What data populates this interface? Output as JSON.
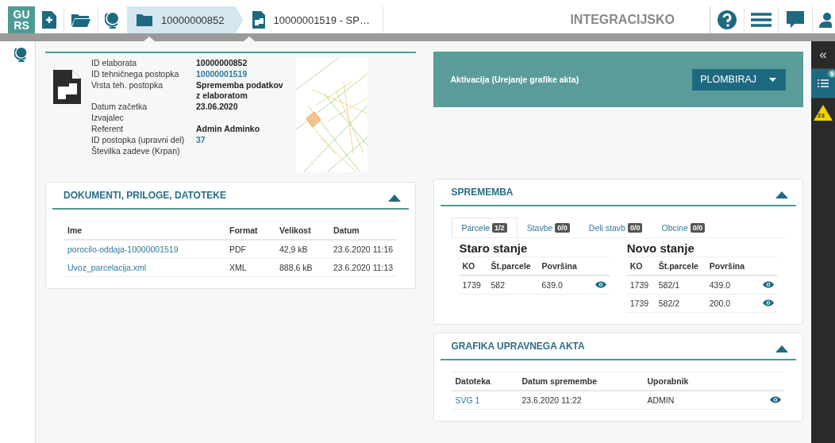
{
  "header": {
    "logo": [
      "GU",
      "RS"
    ],
    "breadcrumbs": [
      {
        "label": "10000000852",
        "selected": true
      },
      {
        "label": "10000001519 - SP…",
        "selected": false
      }
    ],
    "environment": "INTEGRACIJSKO"
  },
  "right_rail": {
    "collapse": "«",
    "badges": [
      {
        "count": "9",
        "kind": "list"
      },
      {
        "count": "23",
        "kind": "warning"
      }
    ]
  },
  "info": {
    "fields": [
      {
        "label": "ID elaborata",
        "value": "10000000852",
        "kind": "text"
      },
      {
        "label": "ID tehničnega postopka",
        "value": "10000001519",
        "kind": "link"
      },
      {
        "label": "Vrsta teh. postopka",
        "value": "Sprememba podatkov z elaboratom",
        "kind": "text"
      },
      {
        "label": "Datum začetka",
        "value": "23.06.2020",
        "kind": "text"
      },
      {
        "label": "Izvajalec"
      },
      {
        "label": "Referent",
        "value": "Admin Adminko",
        "kind": "text"
      },
      {
        "label": "ID postopka (upravni del)",
        "value": "37",
        "kind": "link"
      },
      {
        "label": "Številka zadeve (Krpan)"
      }
    ]
  },
  "activation": {
    "text": "Aktivacija (Urejanje grafike akta)",
    "button": "PLOMBIRAJ"
  },
  "documents": {
    "title": "DOKUMENTI, PRILOGE, DATOTEKE",
    "expanded": true,
    "columns": [
      "Ime",
      "Format",
      "Velikost",
      "Datum"
    ],
    "rows": [
      [
        "porocilo-oddaja-10000001519",
        "PDF",
        "42,9 kB",
        "23.6.2020 11:16"
      ],
      [
        "Uvoz_parcelacija.xml",
        "XML",
        "888,6 kB",
        "23.6.2020 11:13"
      ]
    ]
  },
  "sprememba": {
    "title": "SPREMEMBA",
    "expanded": true,
    "tabs": [
      {
        "label": "Parcele",
        "count": "1/2",
        "selected": true
      },
      {
        "label": "Stavbe",
        "count": "0/0",
        "selected": false
      },
      {
        "label": "Deli stavb",
        "count": "0/0",
        "selected": false
      },
      {
        "label": "Obcine",
        "count": "0/0",
        "selected": false
      }
    ],
    "tables": [
      {
        "title": "Staro stanje",
        "columns": [
          "KO",
          "Št.parcele",
          "Površina"
        ],
        "rows": [
          [
            "1739",
            "582",
            "639.0"
          ]
        ]
      },
      {
        "title": "Novo stanje",
        "columns": [
          "KO",
          "Št.parcele",
          "Površina"
        ],
        "rows": [
          [
            "1739",
            "582/1",
            "439.0"
          ],
          [
            "1739",
            "582/2",
            "200.0"
          ]
        ]
      }
    ]
  },
  "grafika": {
    "title": "GRAFIKA UPRAVNEGA AKTA",
    "expanded": true,
    "columns": [
      "Datoteka",
      "Datum spremembe",
      "Uporabnik"
    ],
    "rows": [
      [
        "SVG 1",
        "23.6.2020 11:22",
        "ADMIN"
      ]
    ]
  }
}
